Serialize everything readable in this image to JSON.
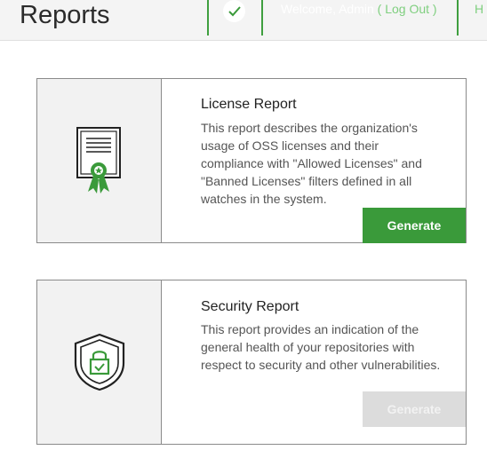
{
  "header": {
    "title": "Reports",
    "welcome_text": "Welcome, Admin",
    "logout_label": "( Log Out )",
    "cut_text": "H"
  },
  "cards": [
    {
      "icon": "certificate-icon",
      "title": "License Report",
      "description": "This report describes the organization's usage of OSS licenses and their compliance with \"Allowed Licenses\" and \"Banned Licenses\" filters defined in all watches in the system.",
      "button_label": "Generate",
      "button_enabled": true
    },
    {
      "icon": "shield-lock-icon",
      "title": "Security Report",
      "description": "This report provides an indication of the general health of your repositories with respect to security and other vulnerabilities.",
      "button_label": "Generate",
      "button_enabled": false
    }
  ],
  "colors": {
    "accent": "#3a9a3a",
    "disabled": "#dcdcdc",
    "header_bg": "#f4f4f4"
  }
}
